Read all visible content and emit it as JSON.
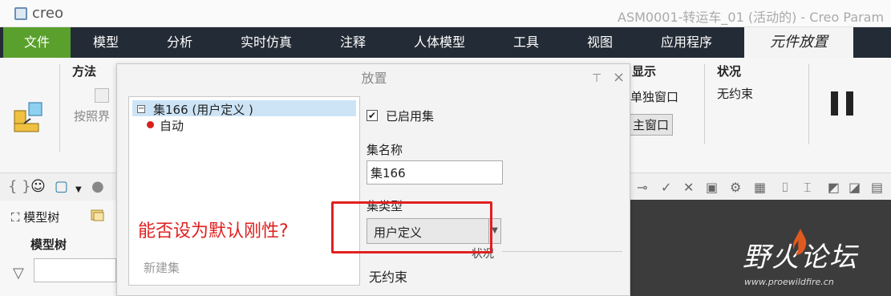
{
  "app": {
    "logo_text": "creo",
    "window_title": "ASM0001-转运车_01 (活动的) - Creo Param"
  },
  "menu": {
    "file": "文件",
    "items": [
      "模型",
      "分析",
      "实时仿真",
      "注释",
      "人体模型",
      "工具",
      "视图",
      "应用程序"
    ],
    "active_tab": "元件放置"
  },
  "ribbon": {
    "method_title": "方法",
    "method_button": "按照界",
    "display_title": "显示",
    "display_single": "单独窗口",
    "display_main": "主窗口",
    "status_title": "状况",
    "status_value": "无约束"
  },
  "model_tree": {
    "tab_label": "模型树",
    "header": "模型树"
  },
  "dialog": {
    "title": "放置",
    "set_name_row": "集166 (用户定义 )",
    "auto_label": "自动",
    "new_set": "新建集",
    "enabled_label": "已启用集",
    "set_name_label": "集名称",
    "set_name_value": "集166",
    "set_type_label": "集类型",
    "set_type_value": "用户定义",
    "status_label": "状况",
    "status_value": "无约束"
  },
  "annotation": {
    "question": "能否设为默认刚性?"
  },
  "watermark": {
    "text": "野火论坛",
    "url": "www.proewildfire.cn"
  },
  "colors": {
    "menubar": "#232b36",
    "file_tab": "#5aa02c",
    "annotation": "#e02020",
    "selection": "#cde4f7"
  }
}
